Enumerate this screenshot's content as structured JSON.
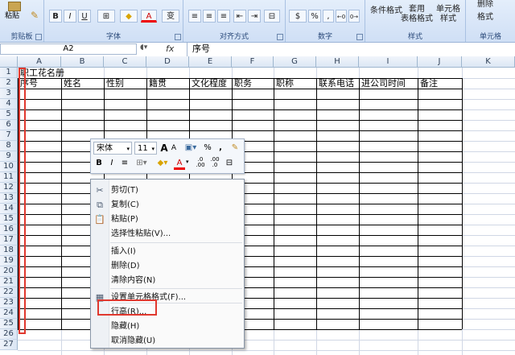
{
  "ribbon": {
    "clipboard": {
      "paste_label": "粘贴",
      "group_label": "剪贴板"
    },
    "font": {
      "group_label": "字体",
      "bold": "B",
      "italic": "I",
      "underline": "U",
      "color_a": "A",
      "wen": "变"
    },
    "alignment": {
      "group_label": "对齐方式"
    },
    "number": {
      "group_label": "数字",
      "percent": "%",
      "comma": ","
    },
    "styles": {
      "group_label": "样式",
      "conditional": "条件格式",
      "table_format": "套用\n表格格式",
      "cell_styles": "单元格\n样式"
    },
    "cells": {
      "group_label": "单元格",
      "delete": "删除",
      "format": "格式"
    }
  },
  "formula_bar": {
    "name_box": "A2",
    "fx": "fx",
    "content": "序号"
  },
  "columns": [
    "A",
    "B",
    "C",
    "D",
    "E",
    "F",
    "G",
    "H",
    "I",
    "J",
    "K"
  ],
  "rows": [
    "1",
    "2",
    "3",
    "4",
    "5",
    "6",
    "7",
    "8",
    "9",
    "10",
    "11",
    "12",
    "13",
    "14",
    "15",
    "16",
    "17",
    "18",
    "19",
    "20",
    "21",
    "22",
    "23",
    "24",
    "25",
    "26",
    "27"
  ],
  "sheet": {
    "title": "职工花名册",
    "headers": [
      "序号",
      "姓名",
      "性别",
      "籍贯",
      "文化程度",
      "职务",
      "职称",
      "联系电话",
      "进公司时间",
      "备注"
    ]
  },
  "mini_toolbar": {
    "font_name": "宋体",
    "font_size": "11",
    "grow": "A",
    "shrink": "A",
    "percent": "%",
    "comma": ",",
    "bold": "B",
    "italic": "I",
    "font_color": "A",
    "inc_decimal": ".0\n.00",
    "dec_decimal": ".00\n.0"
  },
  "context_menu": {
    "items": [
      {
        "label": "剪切(T)",
        "icon": "scissors-icon"
      },
      {
        "label": "复制(C)",
        "icon": "copy-icon"
      },
      {
        "label": "粘贴(P)",
        "icon": "paste-icon"
      },
      {
        "label": "选择性粘贴(V)...",
        "icon": ""
      },
      {
        "label": "插入(I)",
        "icon": ""
      },
      {
        "label": "删除(D)",
        "icon": ""
      },
      {
        "label": "清除内容(N)",
        "icon": ""
      },
      {
        "label": "设置单元格格式(F)...",
        "icon": "format-cells-icon"
      },
      {
        "label": "行高(R)...",
        "icon": ""
      },
      {
        "label": "隐藏(H)",
        "icon": ""
      },
      {
        "label": "取消隐藏(U)",
        "icon": ""
      }
    ]
  },
  "colors": {
    "selection_highlight": "#e0382e",
    "ribbon_bg": "#cfdff5",
    "header_bg": "#dbe6f4"
  }
}
